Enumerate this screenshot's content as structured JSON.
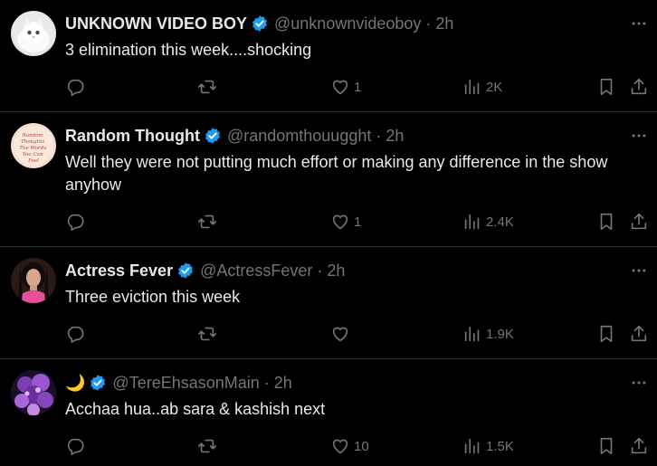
{
  "tweets": [
    {
      "name": "UNKNOWN VIDEO BOY",
      "handle": "@unknownvideoboy",
      "separator": "·",
      "time": "2h",
      "text": "3 elimination this week....shocking",
      "replies": "",
      "retweets": "",
      "likes": "1",
      "views": "2K",
      "avatar": "white-kitten"
    },
    {
      "name": "Random Thought",
      "handle": "@randomthouugght",
      "separator": "·",
      "time": "2h",
      "text": "Well they were not putting much effort or making any difference in the show anyhow",
      "replies": "",
      "retweets": "",
      "likes": "1",
      "views": "2.4K",
      "avatar": "handwritten-card",
      "avatar_text": [
        "Random",
        "Thoughts",
        "The Words",
        "You Can",
        "Feel"
      ]
    },
    {
      "name": "Actress Fever",
      "handle": "@ActressFever",
      "separator": "·",
      "time": "2h",
      "text": "Three eviction this week",
      "replies": "",
      "retweets": "",
      "likes": "",
      "views": "1.9K",
      "avatar": "portrait-photo"
    },
    {
      "name": "🌙",
      "handle": "@TereEhsasonMain",
      "separator": "·",
      "time": "2h",
      "text": "Acchaa hua..ab sara & kashish next",
      "replies": "",
      "retweets": "",
      "likes": "10",
      "views": "1.5K",
      "avatar": "purple-flowers"
    }
  ],
  "colors": {
    "background": "#000000",
    "text": "#e7e9ea",
    "muted": "#71767b",
    "divider": "#2f3336",
    "verified": "#1d9bf0"
  },
  "icons": [
    "reply-icon",
    "retweet-icon",
    "like-icon",
    "views-icon",
    "bookmark-icon",
    "share-icon",
    "more-icon",
    "verified-badge-icon"
  ]
}
